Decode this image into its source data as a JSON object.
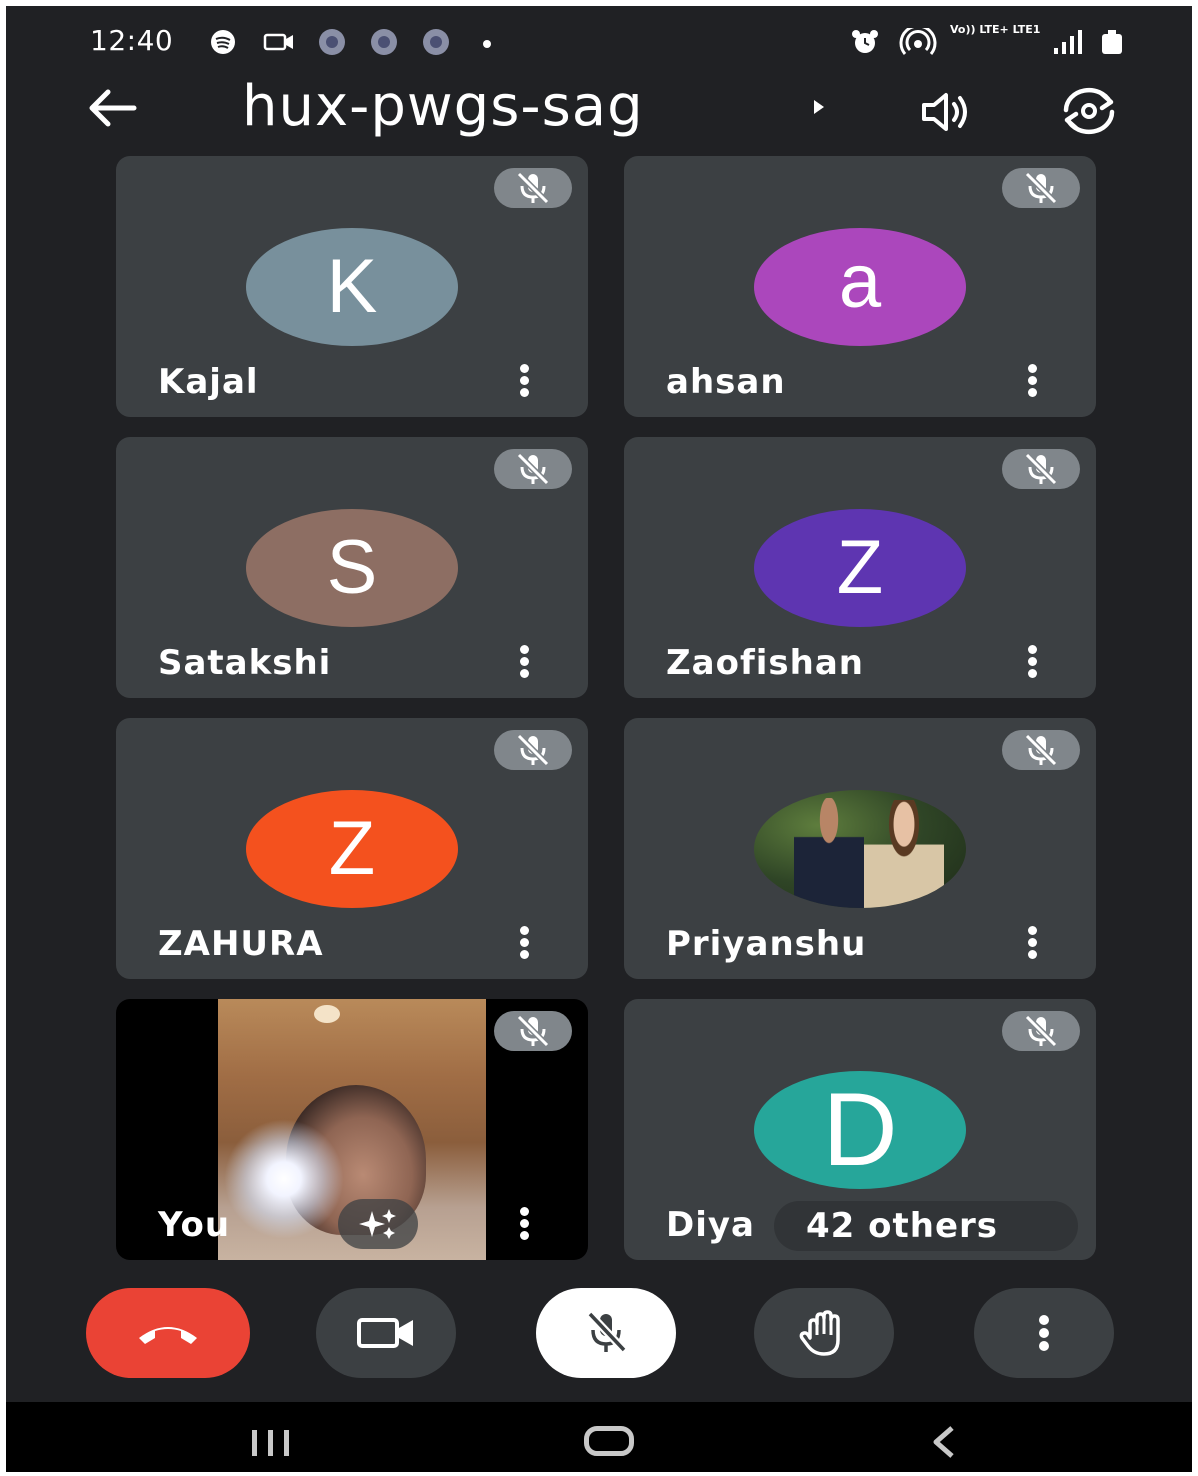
{
  "status_bar": {
    "time": "12:40",
    "network": "Vo)) LTE+ LTE1"
  },
  "header": {
    "meeting_code": "hux-pwgs-sag"
  },
  "participants": [
    {
      "name": "Kajal",
      "initial": "K",
      "color": "#78909c",
      "muted": true
    },
    {
      "name": "ahsan",
      "initial": "a",
      "color": "#ab47bc",
      "muted": true
    },
    {
      "name": "Satakshi",
      "initial": "S",
      "color": "#8d6e63",
      "muted": true
    },
    {
      "name": "Zaofishan",
      "initial": "Z",
      "color": "#5e35b1",
      "muted": true
    },
    {
      "name": "ZAHURA",
      "initial": "Z",
      "color": "#f4511e",
      "muted": true
    },
    {
      "name": "Priyanshu",
      "initial": "",
      "color": "#2f4526",
      "muted": true
    },
    {
      "name": "You",
      "initial": "",
      "color": "#000000",
      "muted": true
    },
    {
      "name": "Diya",
      "initial": "D",
      "color": "#26a69a",
      "muted": true
    }
  ],
  "others": {
    "label": "42 others"
  },
  "controls": {
    "end_call": "end-call",
    "camera": "camera",
    "microphone": "mic-off",
    "raise_hand": "raise-hand",
    "more": "more-options"
  },
  "colors": {
    "end_call": "#ea4335",
    "background": "#202124",
    "tile": "#3c4043"
  }
}
